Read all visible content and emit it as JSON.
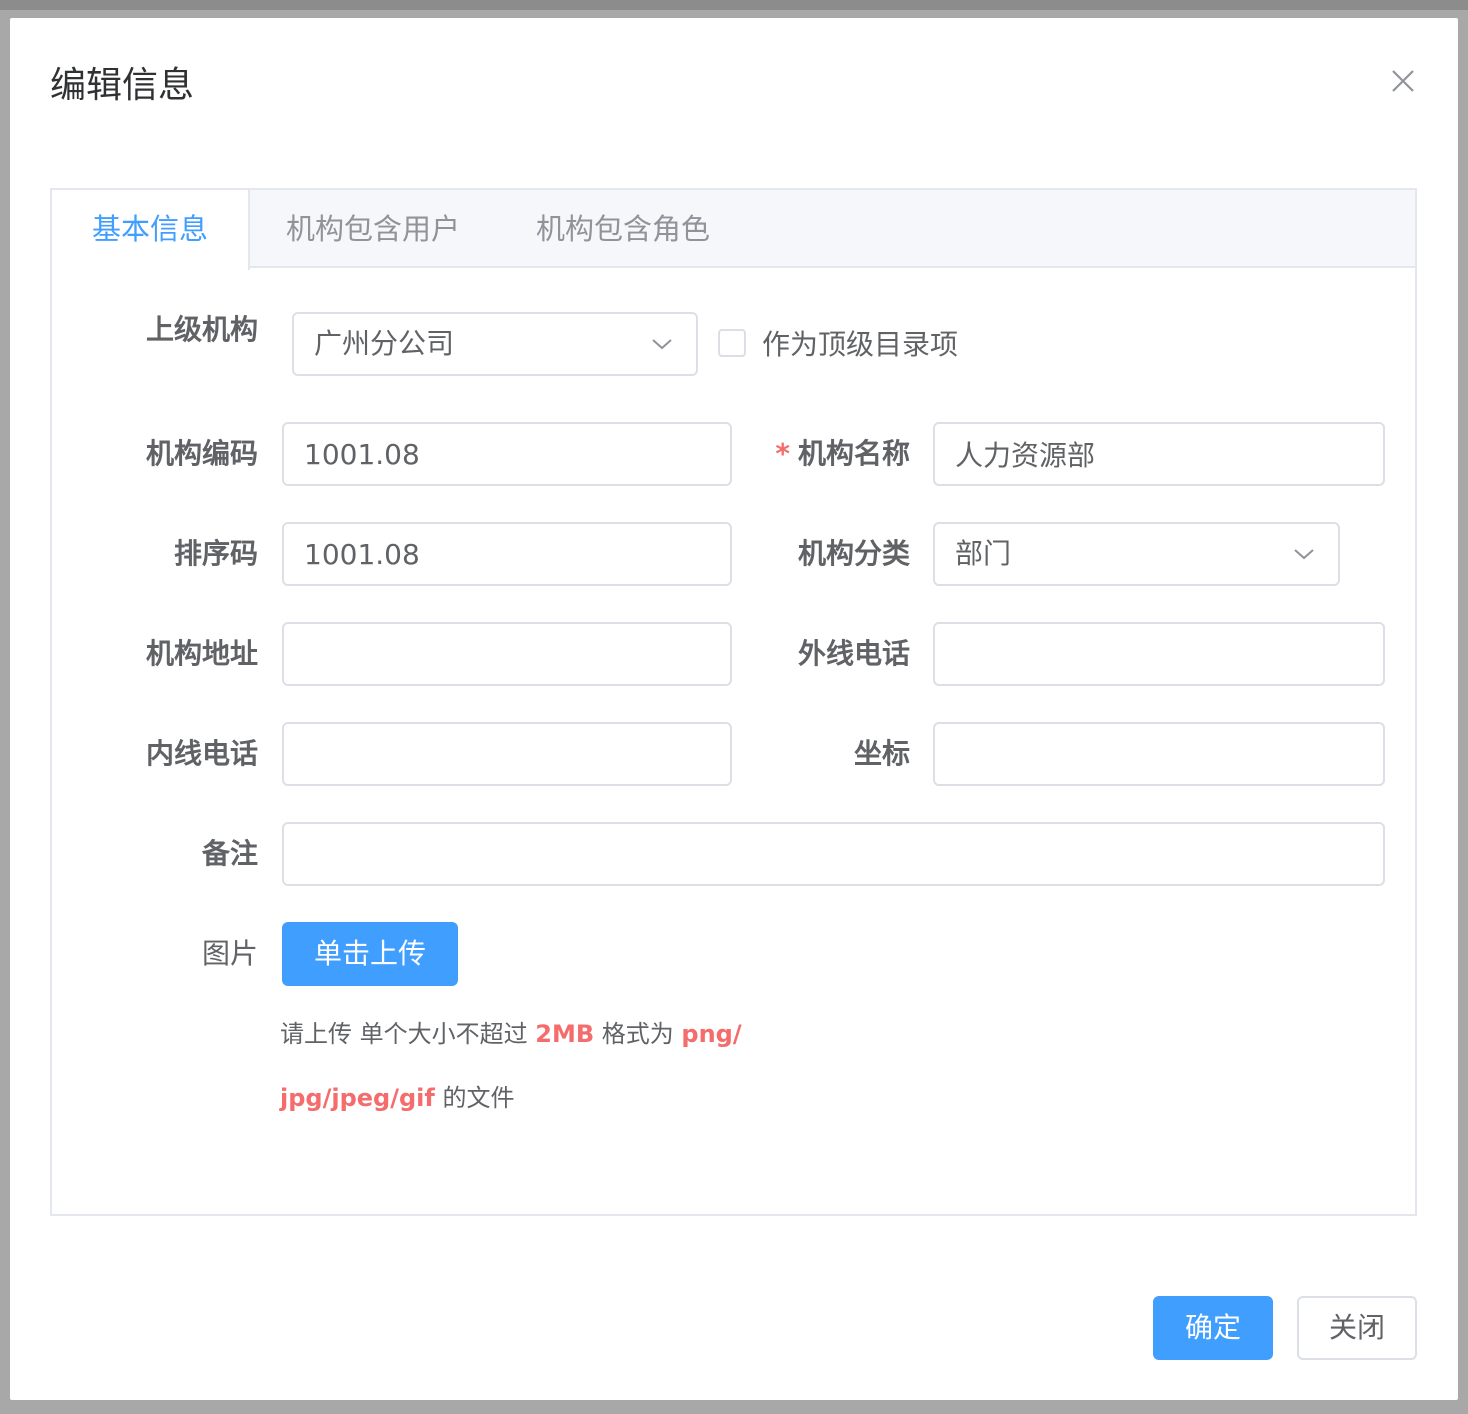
{
  "dialog": {
    "title": "编辑信息"
  },
  "tabs": [
    {
      "label": "基本信息",
      "active": true
    },
    {
      "label": "机构包含用户",
      "active": false
    },
    {
      "label": "机构包含角色",
      "active": false
    }
  ],
  "form": {
    "parent_org": {
      "label": "上级机构",
      "value": "广州分公司"
    },
    "top_level": {
      "label": "作为顶级目录项",
      "checked": false
    },
    "org_code": {
      "label": "机构编码",
      "value": "1001.08"
    },
    "org_name": {
      "label": "机构名称",
      "required_mark": "*",
      "value": "人力资源部"
    },
    "sort_code": {
      "label": "排序码",
      "value": "1001.08"
    },
    "org_type": {
      "label": "机构分类",
      "value": "部门"
    },
    "address": {
      "label": "机构地址",
      "value": ""
    },
    "external_phone": {
      "label": "外线电话",
      "value": ""
    },
    "internal_phone": {
      "label": "内线电话",
      "value": ""
    },
    "coordinates": {
      "label": "坐标",
      "value": ""
    },
    "remark": {
      "label": "备注",
      "value": ""
    },
    "image": {
      "label": "图片",
      "upload_label": "单击上传",
      "tip_prefix": "请上传 单个大小不超过 ",
      "tip_size": "2MB",
      "tip_mid": " 格式为 ",
      "tip_formats_1": "png/",
      "tip_formats_2": "jpg/jpeg/gif",
      "tip_suffix": " 的文件"
    }
  },
  "footer": {
    "confirm_label": "确定",
    "close_label": "关闭"
  },
  "colors": {
    "primary": "#409eff",
    "danger": "#f56c6c",
    "text": "#606266",
    "border": "#dcdfe6"
  }
}
